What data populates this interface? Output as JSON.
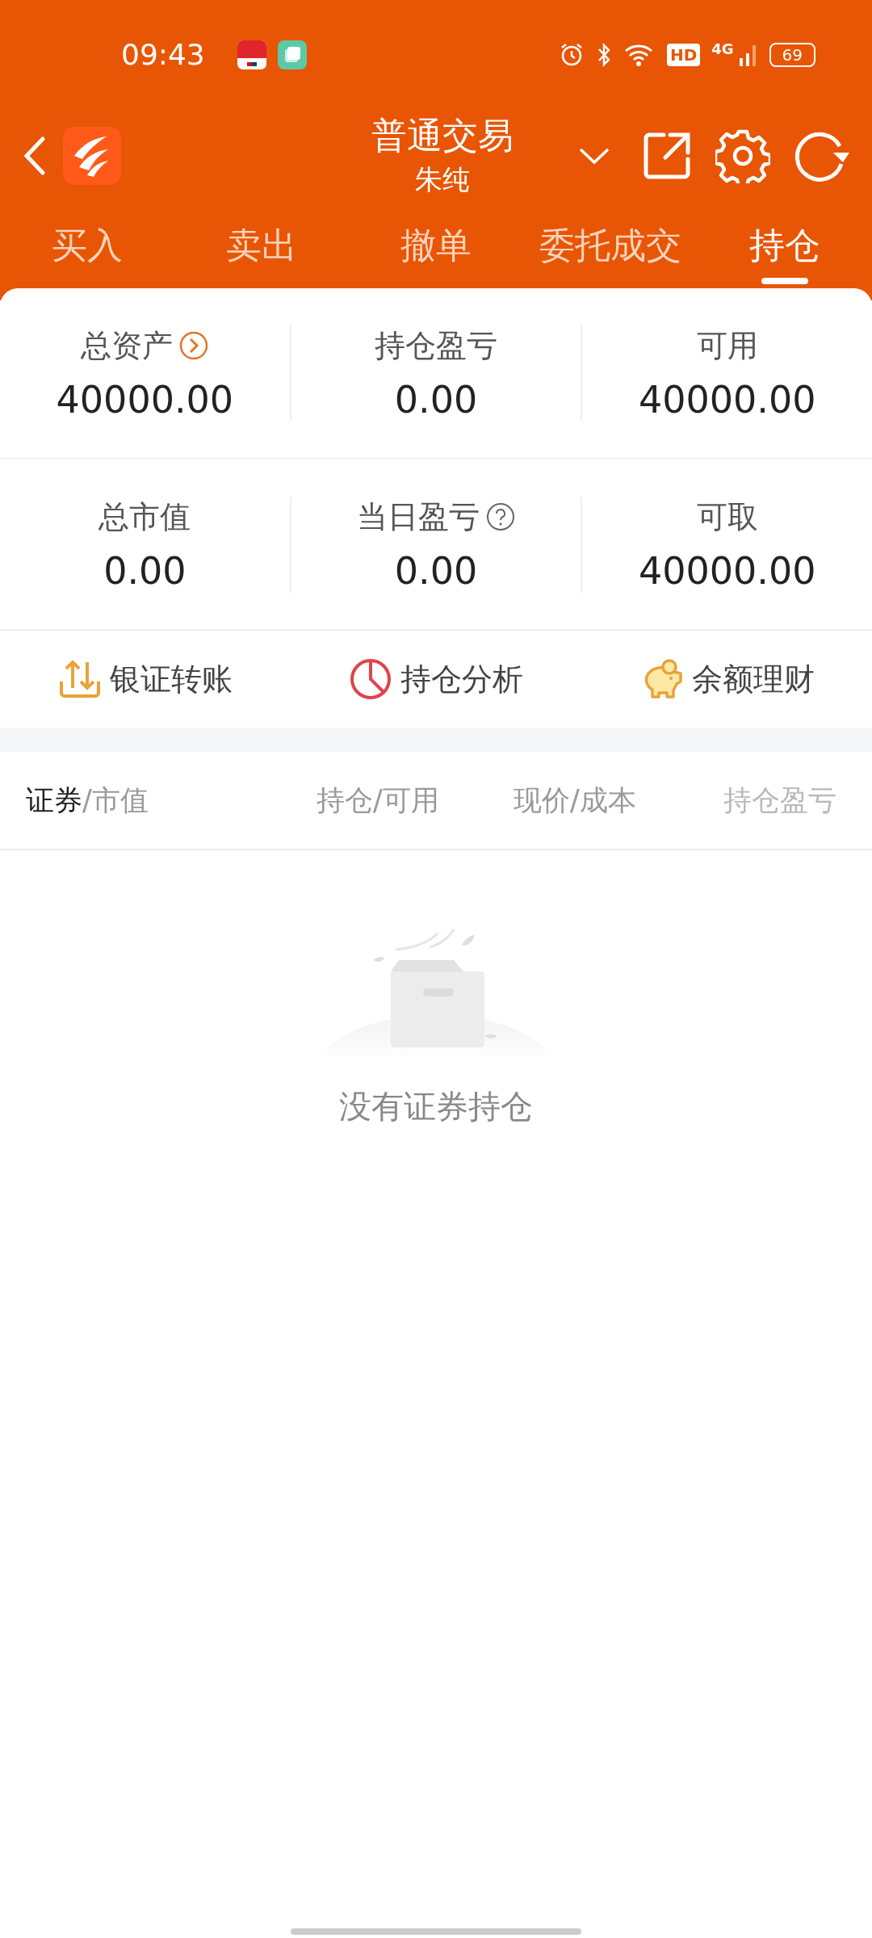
{
  "status_bar": {
    "time": "09:43",
    "hd": "HD",
    "network": "4G",
    "battery": "69"
  },
  "header": {
    "title": "普通交易",
    "subtitle": "朱纯"
  },
  "tabs": [
    {
      "label": "买入",
      "selected": false
    },
    {
      "label": "卖出",
      "selected": false
    },
    {
      "label": "撤单",
      "selected": false
    },
    {
      "label": "委托成交",
      "selected": false
    },
    {
      "label": "持仓",
      "selected": true
    }
  ],
  "summary": [
    [
      {
        "label": "总资产",
        "value": "40000.00",
        "kind": "link"
      },
      {
        "label": "持仓盈亏",
        "value": "0.00",
        "kind": "plain"
      },
      {
        "label": "可用",
        "value": "40000.00",
        "kind": "plain"
      }
    ],
    [
      {
        "label": "总市值",
        "value": "0.00",
        "kind": "plain"
      },
      {
        "label": "当日盈亏",
        "value": "0.00",
        "kind": "help"
      },
      {
        "label": "可取",
        "value": "40000.00",
        "kind": "plain"
      }
    ]
  ],
  "actions": [
    {
      "label": "银证转账",
      "kind": "transfer"
    },
    {
      "label": "持仓分析",
      "kind": "analysis"
    },
    {
      "label": "余额理财",
      "kind": "savings"
    }
  ],
  "table": {
    "columns": [
      {
        "primary": "证券",
        "secondary": "/市值"
      },
      {
        "secondary": "持仓/可用"
      },
      {
        "secondary": "现价/成本"
      },
      {
        "secondary": "持仓盈亏"
      }
    ]
  },
  "empty_state": {
    "message": "没有证券持仓"
  }
}
